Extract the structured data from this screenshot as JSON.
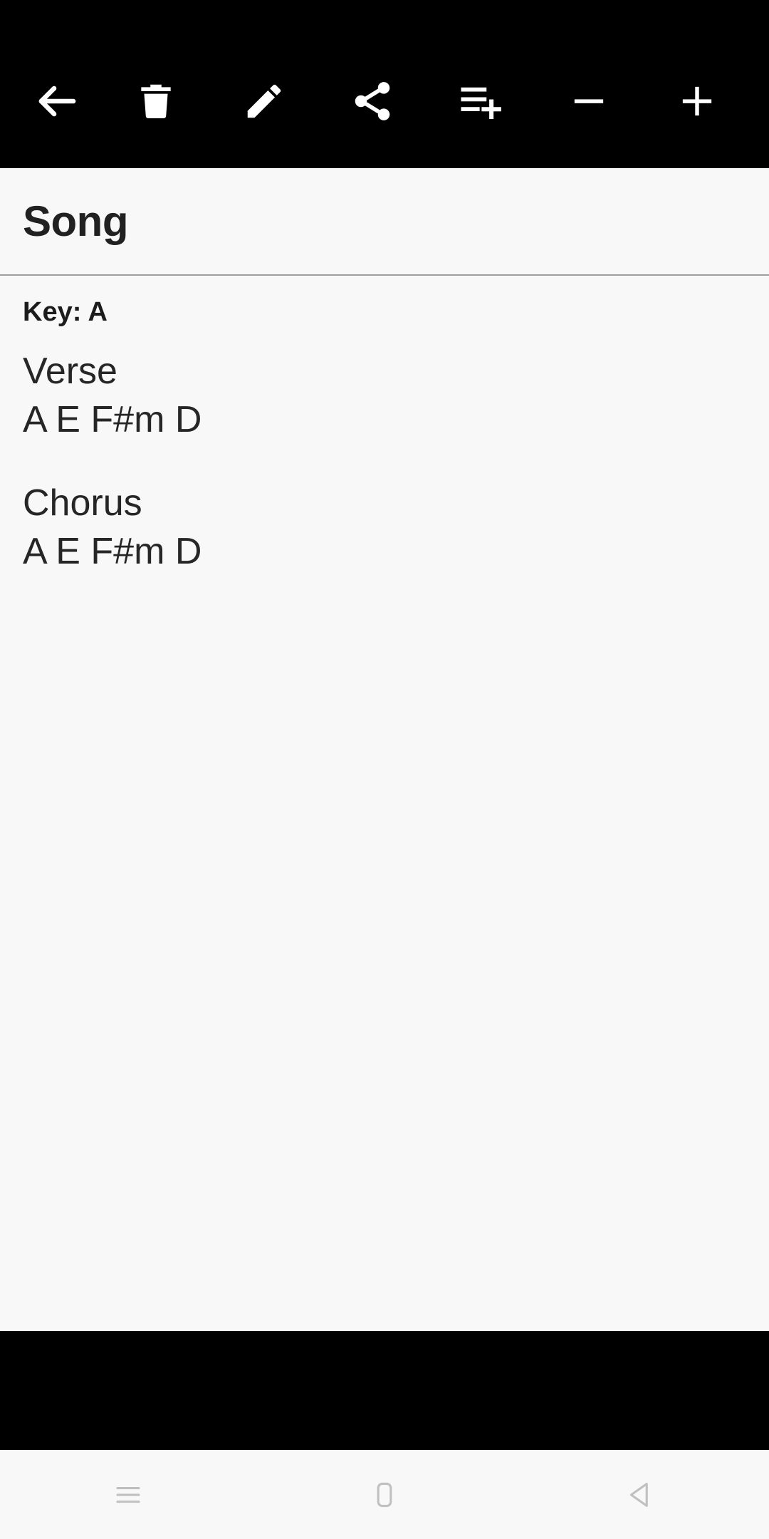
{
  "app": {
    "screen_name": "Song detail",
    "background_color": "#f8f8f8",
    "toolbar_color": "#000000",
    "text_color": "#262626"
  },
  "toolbar": {
    "buttons": [
      {
        "name": "back-arrow-icon",
        "label": "Back"
      },
      {
        "name": "trash-icon",
        "label": "Delete"
      },
      {
        "name": "pencil-icon",
        "label": "Edit"
      },
      {
        "name": "share-icon",
        "label": "Share"
      },
      {
        "name": "playlist-add-icon",
        "label": "Add to set list"
      },
      {
        "name": "minus-icon",
        "label": "Transpose down"
      },
      {
        "name": "plus-icon",
        "label": "Transpose up"
      }
    ]
  },
  "header": {
    "title": "Song"
  },
  "song": {
    "key_line": "Key: A",
    "sections": [
      {
        "name": "Verse",
        "chords": "A E F#m D"
      },
      {
        "name": "Chorus",
        "chords": "A E F#m D"
      }
    ]
  },
  "nav_bar": {
    "buttons": [
      {
        "name": "recents-icon",
        "label": "Recents"
      },
      {
        "name": "home-icon",
        "label": "Home"
      },
      {
        "name": "back-icon",
        "label": "Back"
      }
    ]
  }
}
